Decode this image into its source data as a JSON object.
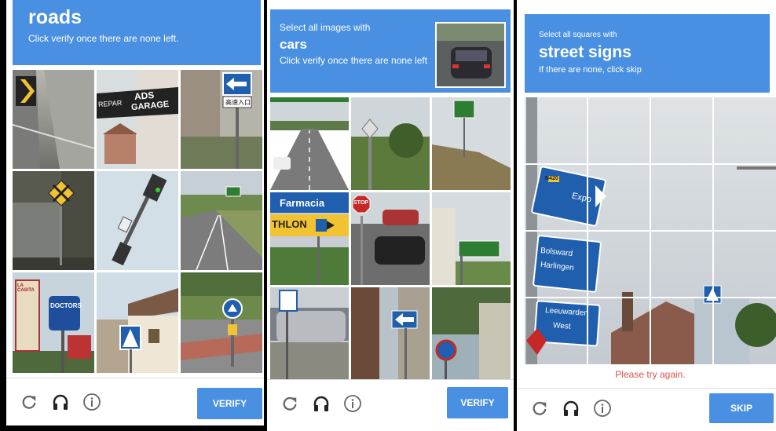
{
  "panel1": {
    "header": {
      "keyword": "roads",
      "instruction": "Click verify once there are none left."
    },
    "tiles": [
      {
        "name": "chevron-road-sign-tile"
      },
      {
        "name": "ads-garage-sign-tile",
        "text1": "ADS",
        "text2": "GARAGE",
        "text3": "REPAR"
      },
      {
        "name": "left-arrow-sign-tile",
        "text1": "高速入口"
      },
      {
        "name": "rail-crossing-sign-tile"
      },
      {
        "name": "traffic-light-tile"
      },
      {
        "name": "highway-road-tile"
      },
      {
        "name": "doctors-sign-tile",
        "text1": "DOCTORS",
        "text2": "LA CASITA"
      },
      {
        "name": "house-crosswalk-sign-tile"
      },
      {
        "name": "roundabout-sign-tile"
      }
    ],
    "button": "VERIFY"
  },
  "panel2": {
    "header": {
      "prefix": "Select all images with",
      "keyword": "cars",
      "instruction": "Click verify once there are none left"
    },
    "tiles": [
      {
        "name": "highway-cars-tile"
      },
      {
        "name": "diamond-sign-trees-tile"
      },
      {
        "name": "green-sign-hill-tile"
      },
      {
        "name": "farmacia-sign-tile",
        "text1": "Farmacia",
        "text2": "THLON"
      },
      {
        "name": "stop-sign-cars-tile",
        "text1": "STOP"
      },
      {
        "name": "green-street-sign-tile"
      },
      {
        "name": "parked-car-sign-tile"
      },
      {
        "name": "arrow-sign-street-tile"
      },
      {
        "name": "round-sign-trees-tile"
      }
    ],
    "button": "VERIFY"
  },
  "panel3": {
    "header": {
      "prefix": "Select all squares with",
      "keyword": "street signs",
      "instruction": "If there are none, click skip"
    },
    "image": {
      "sign1": "Expo",
      "sign1_small": "N420",
      "sign2a": "Bolsward",
      "sign2b": "Harlingen",
      "sign3a": "Leeuwarden",
      "sign3b": "West"
    },
    "error": "Please try again.",
    "button": "SKIP"
  },
  "icons": [
    "reload-icon",
    "audio-headphones-icon",
    "info-icon"
  ],
  "colors": {
    "accent": "#4a90e2",
    "error": "#d9534f"
  }
}
